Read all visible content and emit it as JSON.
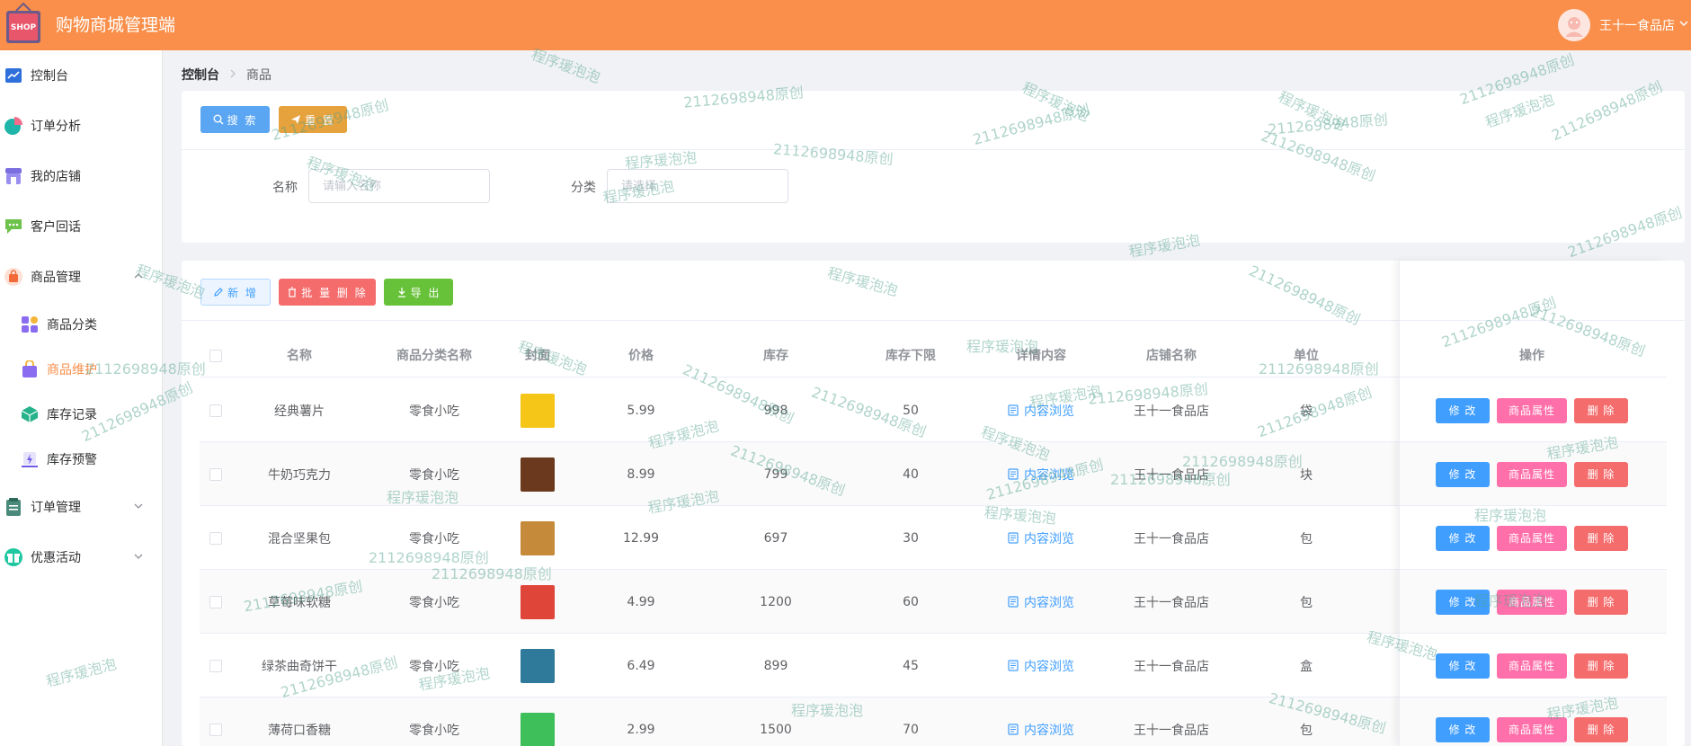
{
  "header": {
    "logo_text": "SHOP",
    "title": "购物商城管理端",
    "user_name": "王十一食品店"
  },
  "sidebar": {
    "items": [
      {
        "label": "控制台",
        "icon": "chart-line-icon"
      },
      {
        "label": "订单分析",
        "icon": "pie-chart-icon"
      },
      {
        "label": "我的店铺",
        "icon": "store-icon"
      },
      {
        "label": "客户回话",
        "icon": "chat-bubble-icon"
      },
      {
        "label": "商品管理",
        "icon": "shopping-bag-icon"
      },
      {
        "label": "订单管理",
        "icon": "clipboard-icon"
      },
      {
        "label": "优惠活动",
        "icon": "gift-icon"
      }
    ],
    "sub_items": [
      {
        "label": "商品分类",
        "icon": "grid-icon"
      },
      {
        "label": "商品维护",
        "icon": "bag-icon"
      },
      {
        "label": "库存记录",
        "icon": "cube-icon"
      },
      {
        "label": "库存预警",
        "icon": "alert-icon"
      }
    ]
  },
  "breadcrumb": {
    "home": "控制台",
    "current": "商品"
  },
  "search": {
    "search_label": "搜 索",
    "reset_label": "重 置",
    "name_label": "名称",
    "name_placeholder": "请输入名称",
    "category_label": "分类",
    "category_placeholder": "请选择"
  },
  "toolbar": {
    "add_label": "新 增",
    "batch_delete_label": "批 量 删 除",
    "export_label": "导 出"
  },
  "table": {
    "columns": [
      "名称",
      "商品分类名称",
      "封面",
      "价格",
      "库存",
      "库存下限",
      "详情内容",
      "店铺名称",
      "单位",
      "操作"
    ],
    "detail_link": "内容浏览",
    "edit_label": "修 改",
    "attr_label": "商品属性",
    "delete_label": "删 除",
    "rows": [
      {
        "name": "经典薯片",
        "category": "零食小吃",
        "price": "5.99",
        "stock": "998",
        "stock_min": "50",
        "shop": "王十一食品店",
        "unit": "袋",
        "cover_color": "#f5c518"
      },
      {
        "name": "牛奶巧克力",
        "category": "零食小吃",
        "price": "8.99",
        "stock": "799",
        "stock_min": "40",
        "shop": "王十一食品店",
        "unit": "块",
        "cover_color": "#6b3a1e"
      },
      {
        "name": "混合坚果包",
        "category": "零食小吃",
        "price": "12.99",
        "stock": "697",
        "stock_min": "30",
        "shop": "王十一食品店",
        "unit": "包",
        "cover_color": "#c58a3a"
      },
      {
        "name": "草莓味软糖",
        "category": "零食小吃",
        "price": "4.99",
        "stock": "1200",
        "stock_min": "60",
        "shop": "王十一食品店",
        "unit": "包",
        "cover_color": "#e0453a"
      },
      {
        "name": "绿茶曲奇饼干",
        "category": "零食小吃",
        "price": "6.49",
        "stock": "899",
        "stock_min": "45",
        "shop": "王十一食品店",
        "unit": "盒",
        "cover_color": "#2f7a9a"
      },
      {
        "name": "薄荷口香糖",
        "category": "零食小吃",
        "price": "2.99",
        "stock": "1500",
        "stock_min": "70",
        "shop": "王十一食品店",
        "unit": "包",
        "cover_color": "#3fbf5a"
      }
    ]
  },
  "watermarks": {
    "a": "程序瑗泡泡",
    "b": "2112698948原创"
  },
  "colors": {
    "brand": "#f98f4a",
    "primary": "#409eff",
    "danger": "#f56c6c",
    "success": "#67c23a",
    "warning": "#e6a23c",
    "pink": "#ff6fa9"
  }
}
